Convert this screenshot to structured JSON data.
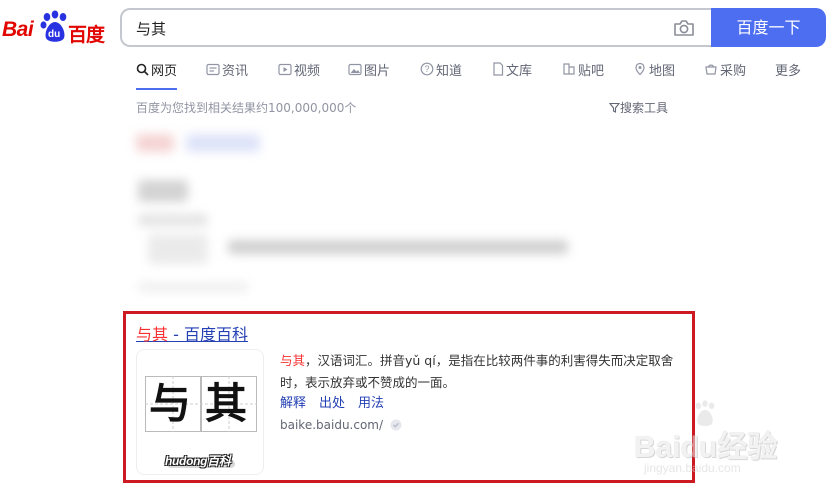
{
  "logo": {
    "latin": "Bai",
    "du": "du",
    "chinese": "百度"
  },
  "search": {
    "query": "与其",
    "button_label": "百度一下"
  },
  "tabs": [
    {
      "label": "网页",
      "icon": "search-icon",
      "active": true
    },
    {
      "label": "资讯",
      "icon": "news-icon"
    },
    {
      "label": "视频",
      "icon": "video-icon"
    },
    {
      "label": "图片",
      "icon": "image-icon"
    },
    {
      "label": "知道",
      "icon": "question-icon"
    },
    {
      "label": "文库",
      "icon": "document-icon"
    },
    {
      "label": "贴吧",
      "icon": "tieba-icon"
    },
    {
      "label": "地图",
      "icon": "map-pin-icon"
    },
    {
      "label": "采购",
      "icon": "basket-icon"
    },
    {
      "label": "更多"
    }
  ],
  "result_count": "百度为您找到相关结果约100,000,000个",
  "search_tools": "搜索工具",
  "result": {
    "title_em": "与其",
    "title_rest": " - 百度百科",
    "thumbnail": {
      "chars": [
        "与",
        "其"
      ],
      "brand": "hudong百科"
    },
    "abstract_em": "与其",
    "abstract_rest": "，汉语词汇。拼音yǔ qí，是指在比较两件事的利害得失而决定取舍时，表示放弃或不赞成的一面。",
    "links": [
      "解释",
      "出处",
      "用法"
    ],
    "source": "baike.baidu.com/"
  },
  "watermark": {
    "main": "Baidu经验",
    "sub": "jingyan.baidu.com"
  },
  "colors": {
    "brand_red": "#e10601",
    "accent_blue": "#4e6ef2",
    "link_blue": "#2440b3",
    "highlight_red": "#cd1a22"
  }
}
